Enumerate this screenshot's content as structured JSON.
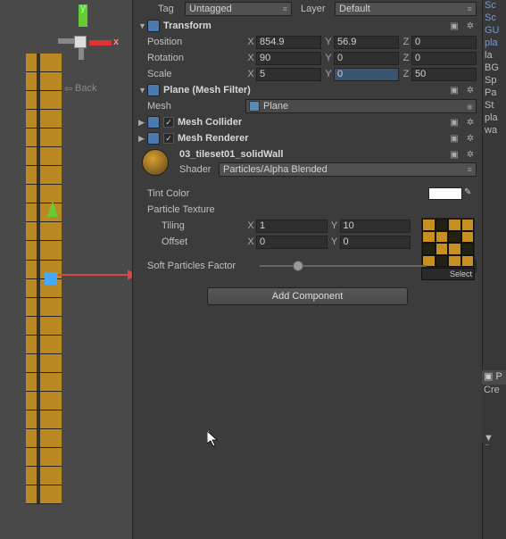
{
  "axis": {
    "y": "y",
    "x": "x",
    "back_arrow": "⇦",
    "back": "Back"
  },
  "tag_row": {
    "tag_label": "Tag",
    "tag_value": "Untagged",
    "layer_label": "Layer",
    "layer_value": "Default"
  },
  "transform": {
    "title": "Transform",
    "position_label": "Position",
    "pos_x": "854.9",
    "pos_y": "56.9",
    "pos_z": "0",
    "rotation_label": "Rotation",
    "rot_x": "90",
    "rot_y": "0",
    "rot_z": "0",
    "scale_label": "Scale",
    "scl_x": "5",
    "scl_y": "0",
    "scl_z": "50",
    "X": "X",
    "Y": "Y",
    "Z": "Z"
  },
  "mesh_filter": {
    "title": "Plane (Mesh Filter)",
    "mesh_label": "Mesh",
    "mesh_value": "Plane"
  },
  "mesh_collider": {
    "title": "Mesh Collider"
  },
  "mesh_renderer": {
    "title": "Mesh Renderer"
  },
  "material": {
    "name": "03_tileset01_solidWall",
    "shader_label": "Shader",
    "shader_value": "Particles/Alpha Blended",
    "tint_label": "Tint Color",
    "tint_color": "#ffffff",
    "particle_tex_label": "Particle Texture",
    "tiling_label": "Tiling",
    "tiling_x": "1",
    "tiling_y": "10",
    "offset_label": "Offset",
    "offset_x": "0",
    "offset_y": "0",
    "X": "X",
    "Y": "Y",
    "select_label": "Select",
    "soft_label": "Soft Particles Factor",
    "soft_value": "1"
  },
  "add_component": "Add Component",
  "right": {
    "items": [
      "Sc",
      "Sc",
      "GU",
      "pla",
      "la",
      "BG",
      "Sp",
      "Pa",
      "St",
      "pla",
      "wa"
    ],
    "proj_header": "P",
    "create": "Cre",
    "folder": "Sc"
  }
}
